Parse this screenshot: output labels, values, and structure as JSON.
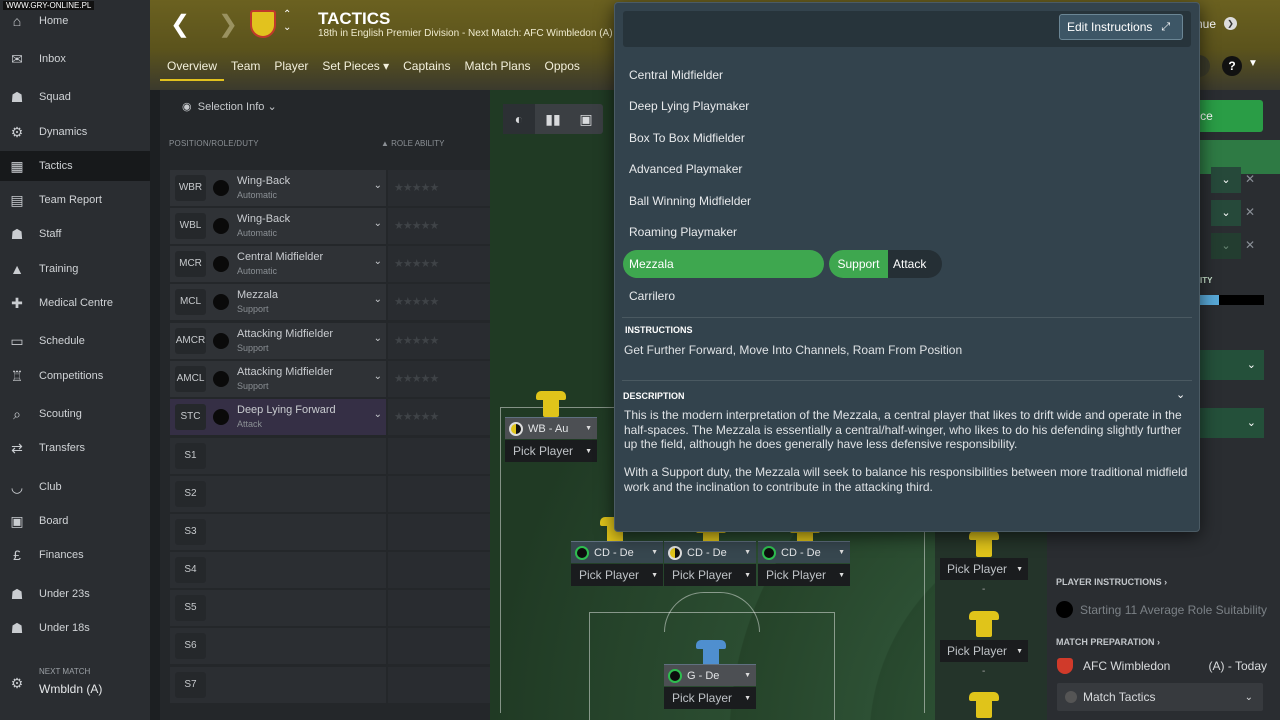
{
  "watermark": "WWW.GRY-ONLINE.PL",
  "sidebar": {
    "items": [
      {
        "label": "Home",
        "icon": "home-icon",
        "glyph": "⌂"
      },
      {
        "label": "Inbox",
        "icon": "inbox-icon",
        "glyph": "✉"
      },
      {
        "label": "Squad",
        "icon": "squad-icon",
        "glyph": "☗"
      },
      {
        "label": "Dynamics",
        "icon": "dynamics-icon",
        "glyph": "⚙"
      },
      {
        "label": "Tactics",
        "icon": "tactics-icon",
        "glyph": "▦"
      },
      {
        "label": "Team Report",
        "icon": "report-icon",
        "glyph": "▤"
      },
      {
        "label": "Staff",
        "icon": "staff-icon",
        "glyph": "☗"
      },
      {
        "label": "Training",
        "icon": "training-icon",
        "glyph": "▲"
      },
      {
        "label": "Medical Centre",
        "icon": "medical-icon",
        "glyph": "✚"
      },
      {
        "label": "Schedule",
        "icon": "schedule-icon",
        "glyph": "▭"
      },
      {
        "label": "Competitions",
        "icon": "trophy-icon",
        "glyph": "♖"
      },
      {
        "label": "Scouting",
        "icon": "scouting-icon",
        "glyph": "⌕"
      },
      {
        "label": "Transfers",
        "icon": "transfers-icon",
        "glyph": "⇄"
      },
      {
        "label": "Club",
        "icon": "club-icon",
        "glyph": "◡"
      },
      {
        "label": "Board",
        "icon": "board-icon",
        "glyph": "▣"
      },
      {
        "label": "Finances",
        "icon": "finances-icon",
        "glyph": "£"
      },
      {
        "label": "Under 23s",
        "icon": "u23-icon",
        "glyph": "☗"
      },
      {
        "label": "Under 18s",
        "icon": "u18-icon",
        "glyph": "☗"
      }
    ],
    "next_match_label": "NEXT MATCH",
    "next_match_value": "Wmbldn (A)"
  },
  "header": {
    "title": "TACTICS",
    "subtitle": "18th in English Premier Division - Next Match: AFC Wimbledon (A) (",
    "tabs": [
      "Overview",
      "Team",
      "Player",
      "Set Pieces ▾",
      "Captains",
      "Match Plans",
      "Oppos"
    ],
    "continue_label": "nue",
    "help_label": "?"
  },
  "left_panel": {
    "selection_info": "Selection Info",
    "col_position": "POSITION/ROLE/DUTY",
    "col_ability": "▲ ROLE ABILITY",
    "slots": [
      {
        "code": "WBR",
        "role": "Wing-Back",
        "duty": "Automatic"
      },
      {
        "code": "WBL",
        "role": "Wing-Back",
        "duty": "Automatic"
      },
      {
        "code": "MCR",
        "role": "Central Midfielder",
        "duty": "Automatic"
      },
      {
        "code": "MCL",
        "role": "Mezzala",
        "duty": "Support"
      },
      {
        "code": "AMCR",
        "role": "Attacking Midfielder",
        "duty": "Support"
      },
      {
        "code": "AMCL",
        "role": "Attacking Midfielder",
        "duty": "Support"
      },
      {
        "code": "STC",
        "role": "Deep Lying Forward",
        "duty": "Attack"
      }
    ],
    "subs": [
      "S1",
      "S2",
      "S3",
      "S4",
      "S5",
      "S6",
      "S7"
    ],
    "stars": "★★★★★"
  },
  "pitch": {
    "wb_card": {
      "role": "WB - Au",
      "pick": "Pick Player"
    },
    "cd_cards": [
      {
        "role": "CD - De",
        "pick": "Pick Player"
      },
      {
        "role": "CD - De",
        "pick": "Pick Player"
      },
      {
        "role": "CD - De",
        "pick": "Pick Player"
      }
    ],
    "gk_card": {
      "role": "G - De",
      "pick": "Pick Player"
    },
    "bench_picks": [
      "Pick Player",
      "Pick Player"
    ],
    "bench_dash": "-"
  },
  "right_panel": {
    "green_button": "ce",
    "ty_label": "ITY",
    "ty_fill_fraction": 0.3,
    "player_instructions": "PLAYER INSTRUCTIONS ›",
    "suitability": "Starting 11 Average Role Suitability",
    "match_preparation": "MATCH PREPARATION ›",
    "opponent": "AFC Wimbledon",
    "opponent_when": "(A) - Today",
    "match_tactics": "Match Tactics"
  },
  "popup": {
    "edit_label": "Edit Instructions",
    "roles": [
      "Central Midfielder",
      "Deep Lying Playmaker",
      "Box To Box Midfielder",
      "Advanced Playmaker",
      "Ball Winning Midfielder",
      "Roaming Playmaker",
      "Mezzala",
      "Carrilero"
    ],
    "selected_role": "Mezzala",
    "duty_selected": "Support",
    "duty_other": "Attack",
    "instructions_head": "INSTRUCTIONS",
    "instructions": "Get Further Forward, Move Into Channels, Roam From Position",
    "description_head": "DESCRIPTION",
    "description_1": "This is the modern interpretation of the Mezzala, a central player that likes to drift wide and operate in the half-spaces. The Mezzala is essentially a central/half-winger, who likes to do his defending slightly further up the field, although he does generally have less defensive responsibility.",
    "description_2": "With a Support duty, the Mezzala will seek to balance his responsibilities between more traditional midfield work and the inclination to contribute in the attacking third."
  },
  "colors": {
    "accent_green": "#3ea74f",
    "header_gold": "#6b6120",
    "popup_bg": "#33434d"
  }
}
